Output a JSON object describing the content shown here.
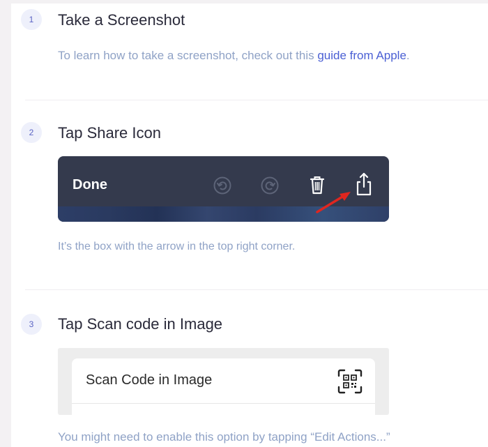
{
  "steps": [
    {
      "number": "1",
      "title": "Take a Screenshot",
      "description_prefix": "To learn how to take a screenshot, check out this ",
      "link_text": "guide from Apple",
      "description_suffix": "."
    },
    {
      "number": "2",
      "title": "Tap Share Icon",
      "description": "It’s the box with the arrow in the top right corner.",
      "image": {
        "done_label": "Done",
        "icons": [
          "undo-icon",
          "redo-icon",
          "trash-icon",
          "share-icon"
        ],
        "annotation": "red-arrow"
      }
    },
    {
      "number": "3",
      "title": "Tap Scan code in Image",
      "description": "You might need to enable this option by tapping “Edit Actions...”",
      "image": {
        "menu_item_label": "Scan Code in Image",
        "icon": "qr-scan-icon"
      }
    }
  ],
  "colors": {
    "page_bg": "#f3f1f3",
    "step_number_bg": "#eef0fb",
    "step_number_text": "#5a63c4",
    "title_text": "#2a2a3a",
    "description_text": "#8fa2c6",
    "link_text": "#4a5fd4",
    "toolbar_bg": "#343a4d",
    "annotation_arrow": "#e0261f"
  }
}
